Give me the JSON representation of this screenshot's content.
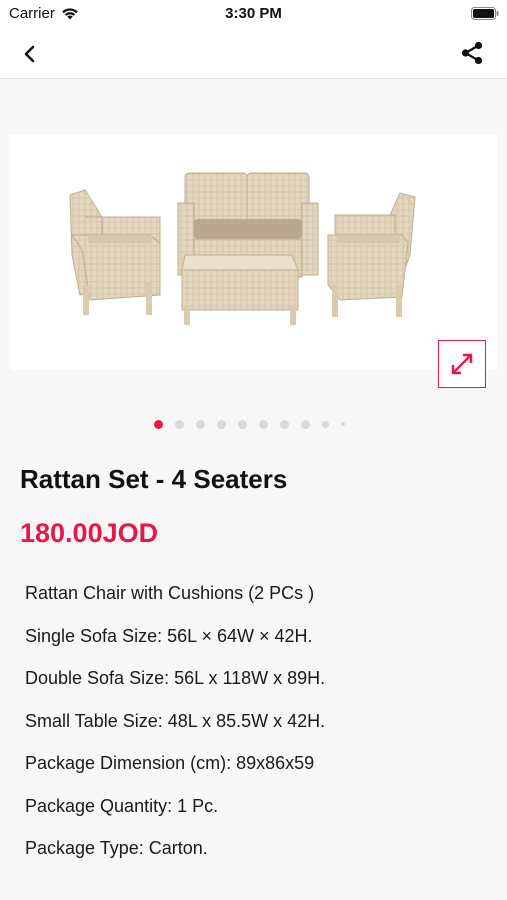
{
  "status_bar": {
    "carrier": "Carrier",
    "time": "3:30 PM"
  },
  "nav": {
    "back_icon": "chevron-left-icon",
    "share_icon": "share-icon"
  },
  "gallery": {
    "image_description_icon": "rattan-furniture-photo",
    "expand_icon": "expand-arrows-icon",
    "total_dots": 10,
    "active_index": 0
  },
  "product": {
    "title": "Rattan Set - 4 Seaters",
    "price": "180.00JOD",
    "details": [
      "Rattan Chair with Cushions (2 PCs )",
      "Single Sofa Size: 56L × 64W × 42H.",
      "Double Sofa Size: 56L x 118W x 89H.",
      "Small Table Size: 48L x 85.5W x 42H.",
      "Package Dimension (cm): 89x86x59",
      "Package Quantity: 1 Pc.",
      "Package Type: Carton."
    ]
  },
  "colors": {
    "accent": "#e8174a",
    "background": "#f7f7f7"
  }
}
